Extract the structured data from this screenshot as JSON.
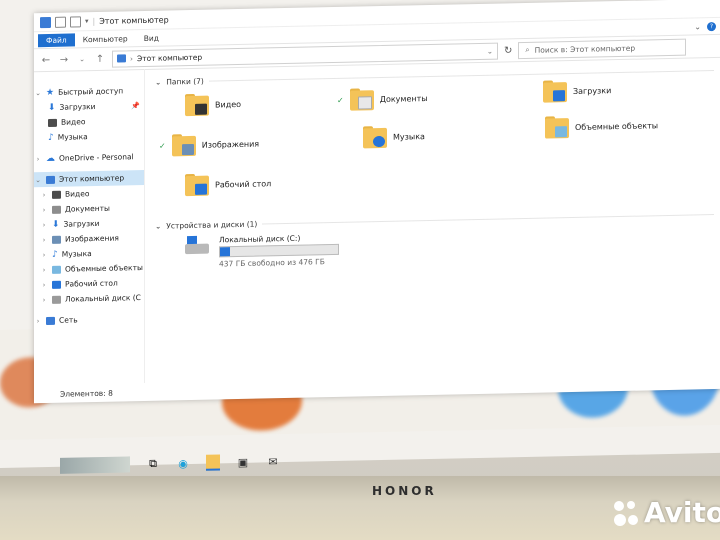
{
  "window": {
    "title": "Этот компьютер",
    "ribbon_tabs": [
      "Файл",
      "Компьютер",
      "Вид"
    ],
    "address_path": "Этот компьютер",
    "search_placeholder": "Поиск в: Этот компьютер",
    "status_text": "Элементов: 8"
  },
  "nav": {
    "quick_access": "Быстрый доступ",
    "quick_items": [
      "Загрузки",
      "Видео",
      "Музыка"
    ],
    "onedrive": "OneDrive - Personal",
    "this_pc": "Этот компьютер",
    "pc_items": [
      "Видео",
      "Документы",
      "Загрузки",
      "Изображения",
      "Музыка",
      "Объемные объекты",
      "Рабочий стол",
      "Локальный диск (C"
    ],
    "network": "Сеть"
  },
  "content": {
    "folders_header": "Папки (7)",
    "folders": [
      "Видео",
      "Документы",
      "Загрузки",
      "Изображения",
      "Музыка",
      "Объемные объекты",
      "Рабочий стол"
    ],
    "devices_header": "Устройства и диски (1)",
    "drive": {
      "name": "Локальный диск (C:)",
      "free_text": "437 ГБ свободно из 476 ГБ",
      "used_fraction": 0.082
    }
  },
  "device": {
    "brand": "HONOR",
    "watermark": "Avito"
  },
  "icons": {
    "taskbar": [
      "task-view-icon",
      "edge-icon",
      "file-explorer-icon",
      "store-icon",
      "mail-icon"
    ]
  },
  "colors": {
    "accent": "#1f6fcf",
    "folder": "#f4c358",
    "selection": "#cce4f7"
  }
}
